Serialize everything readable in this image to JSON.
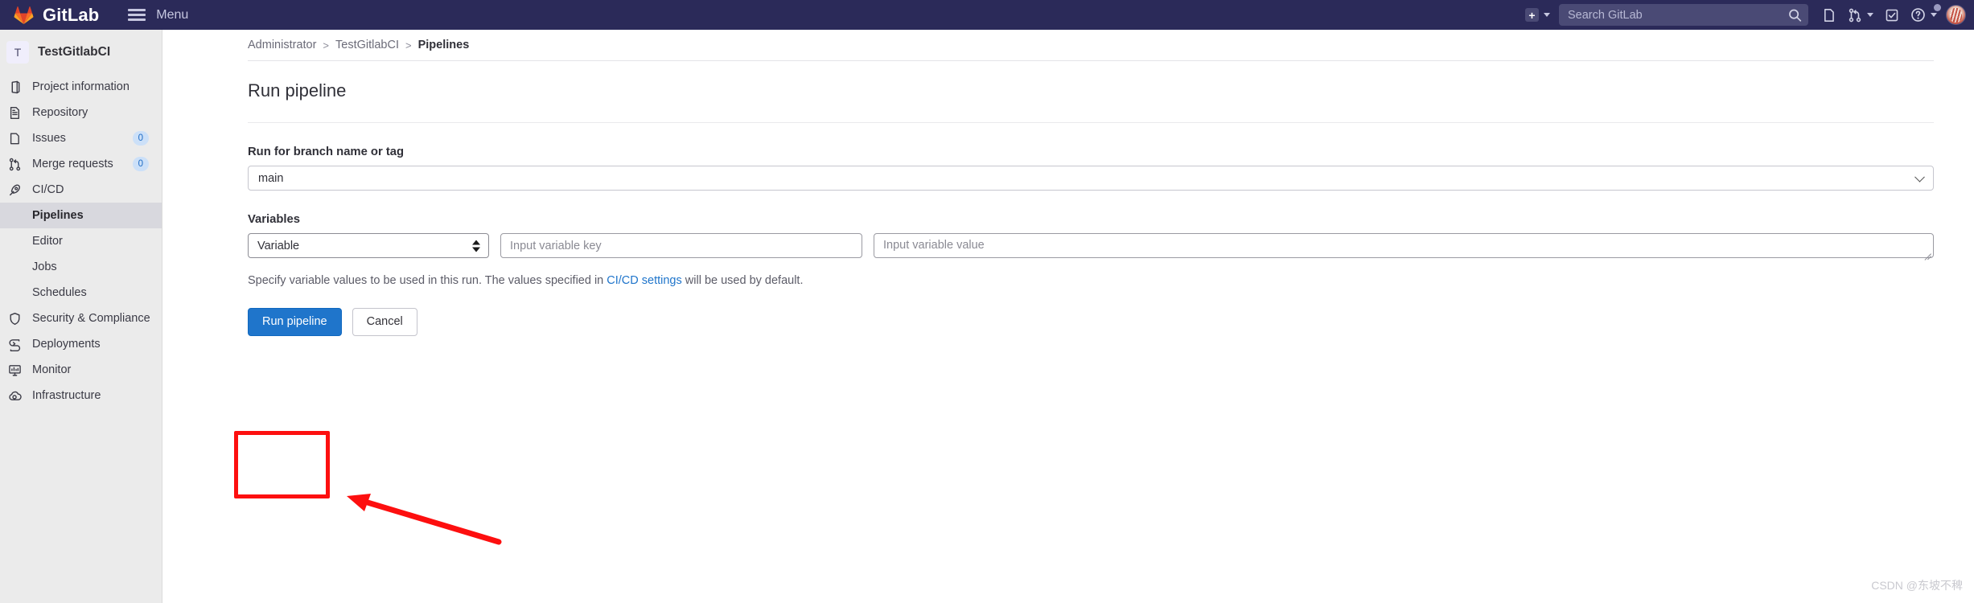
{
  "topbar": {
    "brand": "GitLab",
    "menu_label": "Menu",
    "plus_label": "+",
    "search_placeholder": "Search GitLab",
    "search_value": "",
    "icons": {
      "search": "search-icon",
      "issues": "issues-icon",
      "merge_requests": "merge-request-icon",
      "todos": "todo-checkbox-icon",
      "help": "help-question-icon",
      "avatar": "user-avatar"
    }
  },
  "sidebar": {
    "project_initial": "T",
    "project_name": "TestGitlabCI",
    "items": [
      {
        "label": "Project information",
        "icon": "project-info-icon",
        "badge": null
      },
      {
        "label": "Repository",
        "icon": "repository-doc-icon",
        "badge": null
      },
      {
        "label": "Issues",
        "icon": "issues-icon",
        "badge": "0"
      },
      {
        "label": "Merge requests",
        "icon": "merge-request-icon",
        "badge": "0"
      },
      {
        "label": "CI/CD",
        "icon": "rocket-icon",
        "badge": null
      }
    ],
    "subitems": [
      {
        "label": "Pipelines",
        "active": true
      },
      {
        "label": "Editor",
        "active": false
      },
      {
        "label": "Jobs",
        "active": false
      },
      {
        "label": "Schedules",
        "active": false
      }
    ],
    "items_after": [
      {
        "label": "Security & Compliance",
        "icon": "shield-icon"
      },
      {
        "label": "Deployments",
        "icon": "deployments-icon"
      },
      {
        "label": "Monitor",
        "icon": "monitor-icon"
      },
      {
        "label": "Infrastructure",
        "icon": "infrastructure-cloud-icon"
      }
    ]
  },
  "breadcrumb": {
    "items": [
      "Administrator",
      "TestGitlabCI",
      "Pipelines"
    ],
    "separator": ">"
  },
  "main": {
    "page_title": "Run pipeline",
    "branch_label": "Run for branch name or tag",
    "branch_value": "main",
    "variables_label": "Variables",
    "variable_type": "Variable",
    "variable_key_placeholder": "Input variable key",
    "variable_key_value": "",
    "variable_value_placeholder": "Input variable value",
    "variable_value_value": "",
    "helper_text_before": "Specify variable values to be used in this run. The values specified in ",
    "helper_link": "CI/CD settings",
    "helper_text_after": " will be used by default.",
    "run_button": "Run pipeline",
    "cancel_button": "Cancel"
  },
  "annotations": {
    "highlight_color": "#fd0f0f",
    "arrow_color": "#fd0f0f"
  },
  "watermark": "CSDN @东坡不稗"
}
